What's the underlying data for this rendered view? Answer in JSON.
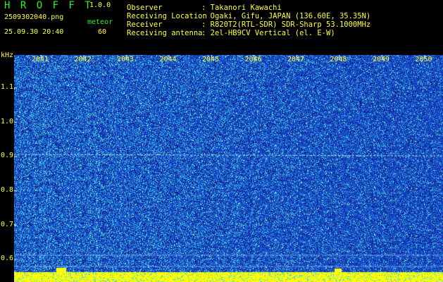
{
  "header": {
    "app_name": "H R O F F T",
    "version": "1.0.0",
    "filename": "2509302040.png",
    "datetime": "25.09.30 20:40",
    "mode_label": "meteor",
    "mode_value": "60"
  },
  "station_info": [
    {
      "key": "Observer",
      "value": ": Takanori Kawachi"
    },
    {
      "key": "Receiving Location",
      "value": ": Ogaki, Gifu, JAPAN (136.60E, 35.35N)"
    },
    {
      "key": "Receiver",
      "value": ": R820T2(RTL-SDR) SDR-Sharp 53.1000MHz"
    },
    {
      "key": "Receiving antenna",
      "value": ": 2el-HB9CV Vertical (el. E-W)"
    }
  ],
  "spectrogram": {
    "unit_label": "kHz",
    "y_ticks": [
      "1.1",
      "1.0",
      "0.9",
      "0.8",
      "0.7",
      "0.6"
    ],
    "y_tick_values": [
      1.1,
      1.0,
      0.9,
      0.8,
      0.7,
      0.6
    ],
    "y_range": [
      0.57,
      1.195
    ],
    "time_ticks": [
      "2041",
      "2042",
      "2043",
      "2044",
      "2045",
      "2046",
      "2047",
      "2048",
      "2049",
      "2050"
    ],
    "carrier_khz": 0.905,
    "colors": {
      "label": "#ffff40",
      "tick": "#ffffff",
      "trace": "#ffff40",
      "background_noise": "#1a2a9a"
    }
  }
}
